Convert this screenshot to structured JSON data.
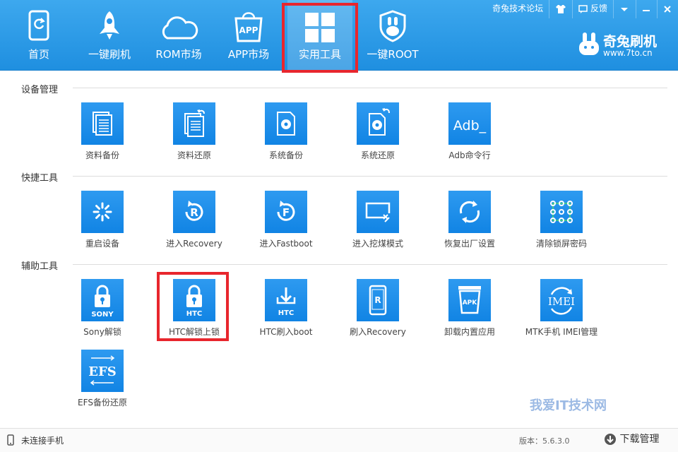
{
  "topbar": {
    "forum_label": "奇兔技术论坛",
    "feedback_label": "反馈"
  },
  "nav": [
    {
      "label": "首页",
      "icon": "home-icon"
    },
    {
      "label": "一键刷机",
      "icon": "rocket-icon"
    },
    {
      "label": "ROM市场",
      "icon": "cloud-icon"
    },
    {
      "label": "APP市场",
      "icon": "app-bag-icon"
    },
    {
      "label": "实用工具",
      "icon": "grid-icon"
    },
    {
      "label": "一键ROOT",
      "icon": "root-shield-icon"
    }
  ],
  "brand": {
    "name": "奇兔刷机",
    "url": "www.7to.cn"
  },
  "sections": {
    "device": "设备管理",
    "quick": "快捷工具",
    "assist": "辅助工具"
  },
  "device_tools": [
    {
      "label": "资料备份",
      "icon": "data-backup-icon"
    },
    {
      "label": "资料还原",
      "icon": "data-restore-icon"
    },
    {
      "label": "系统备份",
      "icon": "system-backup-icon"
    },
    {
      "label": "系统还原",
      "icon": "system-restore-icon"
    },
    {
      "label": "Adb命令行",
      "icon": "adb-icon",
      "tile_text": "Adb_"
    }
  ],
  "quick_tools": [
    {
      "label": "重启设备",
      "icon": "reboot-icon"
    },
    {
      "label": "进入Recovery",
      "icon": "recovery-icon"
    },
    {
      "label": "进入Fastboot",
      "icon": "fastboot-icon"
    },
    {
      "label": "进入挖煤模式",
      "icon": "download-mode-icon"
    },
    {
      "label": "恢复出厂设置",
      "icon": "factory-reset-icon"
    },
    {
      "label": "清除锁屏密码",
      "icon": "clear-pattern-icon"
    }
  ],
  "assist_tools": [
    {
      "label": "Sony解锁",
      "icon": "sony-lock-icon",
      "tile_text": "SONY"
    },
    {
      "label": "HTC解锁上锁",
      "icon": "htc-lock-icon",
      "tile_text": "HTC"
    },
    {
      "label": "HTC刷入boot",
      "icon": "htc-boot-icon",
      "tile_text": "HTC"
    },
    {
      "label": "刷入Recovery",
      "icon": "flash-recovery-icon",
      "tile_text": "R"
    },
    {
      "label": "卸载内置应用",
      "icon": "apk-uninstall-icon",
      "tile_text": "APK"
    },
    {
      "label": "MTK手机 IMEI管理",
      "icon": "imei-icon",
      "tile_text": "IMEI"
    },
    {
      "label": "EFS备份还原",
      "icon": "efs-icon",
      "tile_text": "EFS"
    }
  ],
  "status": {
    "connection": "未连接手机",
    "version": "版本：5.6.3.0",
    "download_label": "下载管理"
  },
  "watermark": "我爱IT技术网"
}
